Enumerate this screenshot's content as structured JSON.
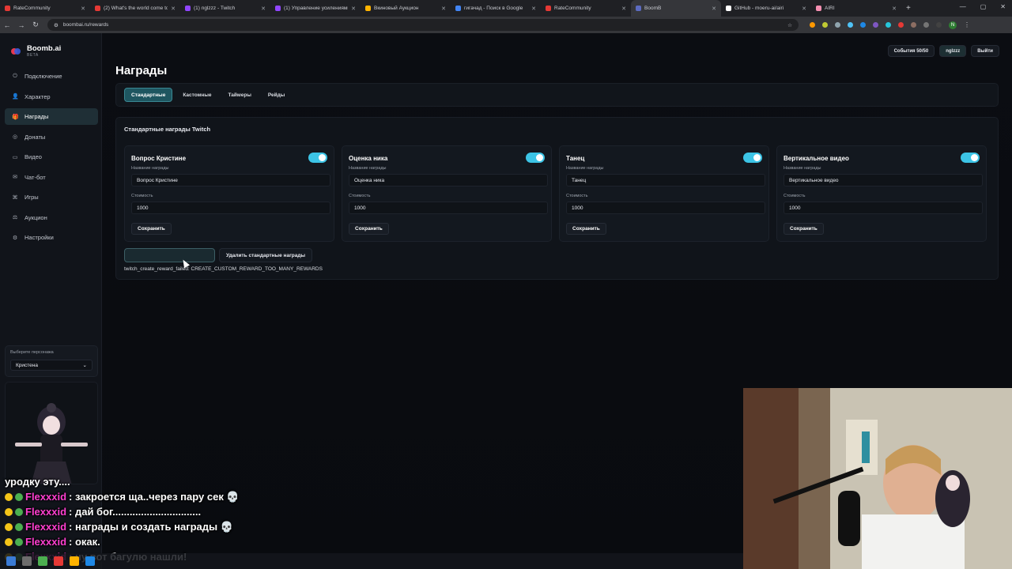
{
  "browser": {
    "tabs": [
      {
        "title": "RateCommunity",
        "color": "#e53935"
      },
      {
        "title": "(2) What's the world come to",
        "color": "#e53935"
      },
      {
        "title": "(1) nglzzz - Twitch",
        "color": "#9146ff"
      },
      {
        "title": "(1) Управление усилениями",
        "color": "#9146ff"
      },
      {
        "title": "Вкиновый Аукцион",
        "color": "#ffb300"
      },
      {
        "title": "гигачад - Поиск в Google",
        "color": "#4285f4"
      },
      {
        "title": "RateCommunity",
        "color": "#e53935"
      },
      {
        "title": "BoomB",
        "color": "#5c6bc0"
      },
      {
        "title": "GitHub - moeru-ai/airi",
        "color": "#ffffff"
      },
      {
        "title": "AIRI",
        "color": "#f48fb1"
      }
    ],
    "url": "boombai.ru/rewards"
  },
  "brand": {
    "name": "Boomb.ai",
    "sub": "BETA"
  },
  "sidebar": {
    "items": [
      {
        "label": "Подключение",
        "icon": "power-icon"
      },
      {
        "label": "Характер",
        "icon": "person-icon"
      },
      {
        "label": "Награды",
        "icon": "gift-icon"
      },
      {
        "label": "Донаты",
        "icon": "coin-icon"
      },
      {
        "label": "Видео",
        "icon": "video-icon"
      },
      {
        "label": "Чат-бот",
        "icon": "chat-icon"
      },
      {
        "label": "Игры",
        "icon": "gamepad-icon"
      },
      {
        "label": "Аукцион",
        "icon": "gavel-icon"
      },
      {
        "label": "Настройки",
        "icon": "gear-icon"
      }
    ],
    "active_index": 2,
    "character_picker": {
      "label": "Выберите персонажа",
      "value": "Кристена"
    }
  },
  "header": {
    "events": "События 50/50",
    "user": "nglzzz",
    "logout": "Выйти"
  },
  "page": {
    "title": "Награды",
    "tabs": [
      "Стандартные",
      "Кастомные",
      "Таймеры",
      "Рейды"
    ],
    "active_tab": 0,
    "section_title": "Стандартные награды Twitch",
    "field_name_label": "Название награды",
    "field_cost_label": "Стоимость",
    "save_label": "Сохранить",
    "cards": [
      {
        "title": "Вопрос Кристине",
        "name": "Вопрос Кристине",
        "cost": "1000",
        "enabled": true
      },
      {
        "title": "Оценка ника",
        "name": "Оценка ника",
        "cost": "1000",
        "enabled": true
      },
      {
        "title": "Танец",
        "name": "Танец",
        "cost": "1000",
        "enabled": true
      },
      {
        "title": "Вертикальное видео",
        "name": "Вертикальное видео",
        "cost": "1000",
        "enabled": true
      }
    ],
    "create_button": "",
    "delete_button": "Удалить стандартные награды",
    "error": "twitch_create_reward_failed: CREATE_CUSTOM_REWARD_TOO_MANY_REWARDS"
  },
  "chat": [
    {
      "user": "",
      "text": "уродку эту...."
    },
    {
      "user": "Flexxxid",
      "text": ": закроется ща..через пару сек 💀"
    },
    {
      "user": "Flexxxid",
      "text": ": дай бог..............................."
    },
    {
      "user": "Flexxxid",
      "text": ": награды и создать награды 💀"
    },
    {
      "user": "Flexxxid",
      "text": ": окак."
    },
    {
      "user": "Flexxxid",
      "text": ": ну вот багулю нашли!"
    }
  ],
  "colors": {
    "accent": "#3cc4e6",
    "active_tab_bg": "#1e5660",
    "chat_user": "#ff3fd0"
  }
}
